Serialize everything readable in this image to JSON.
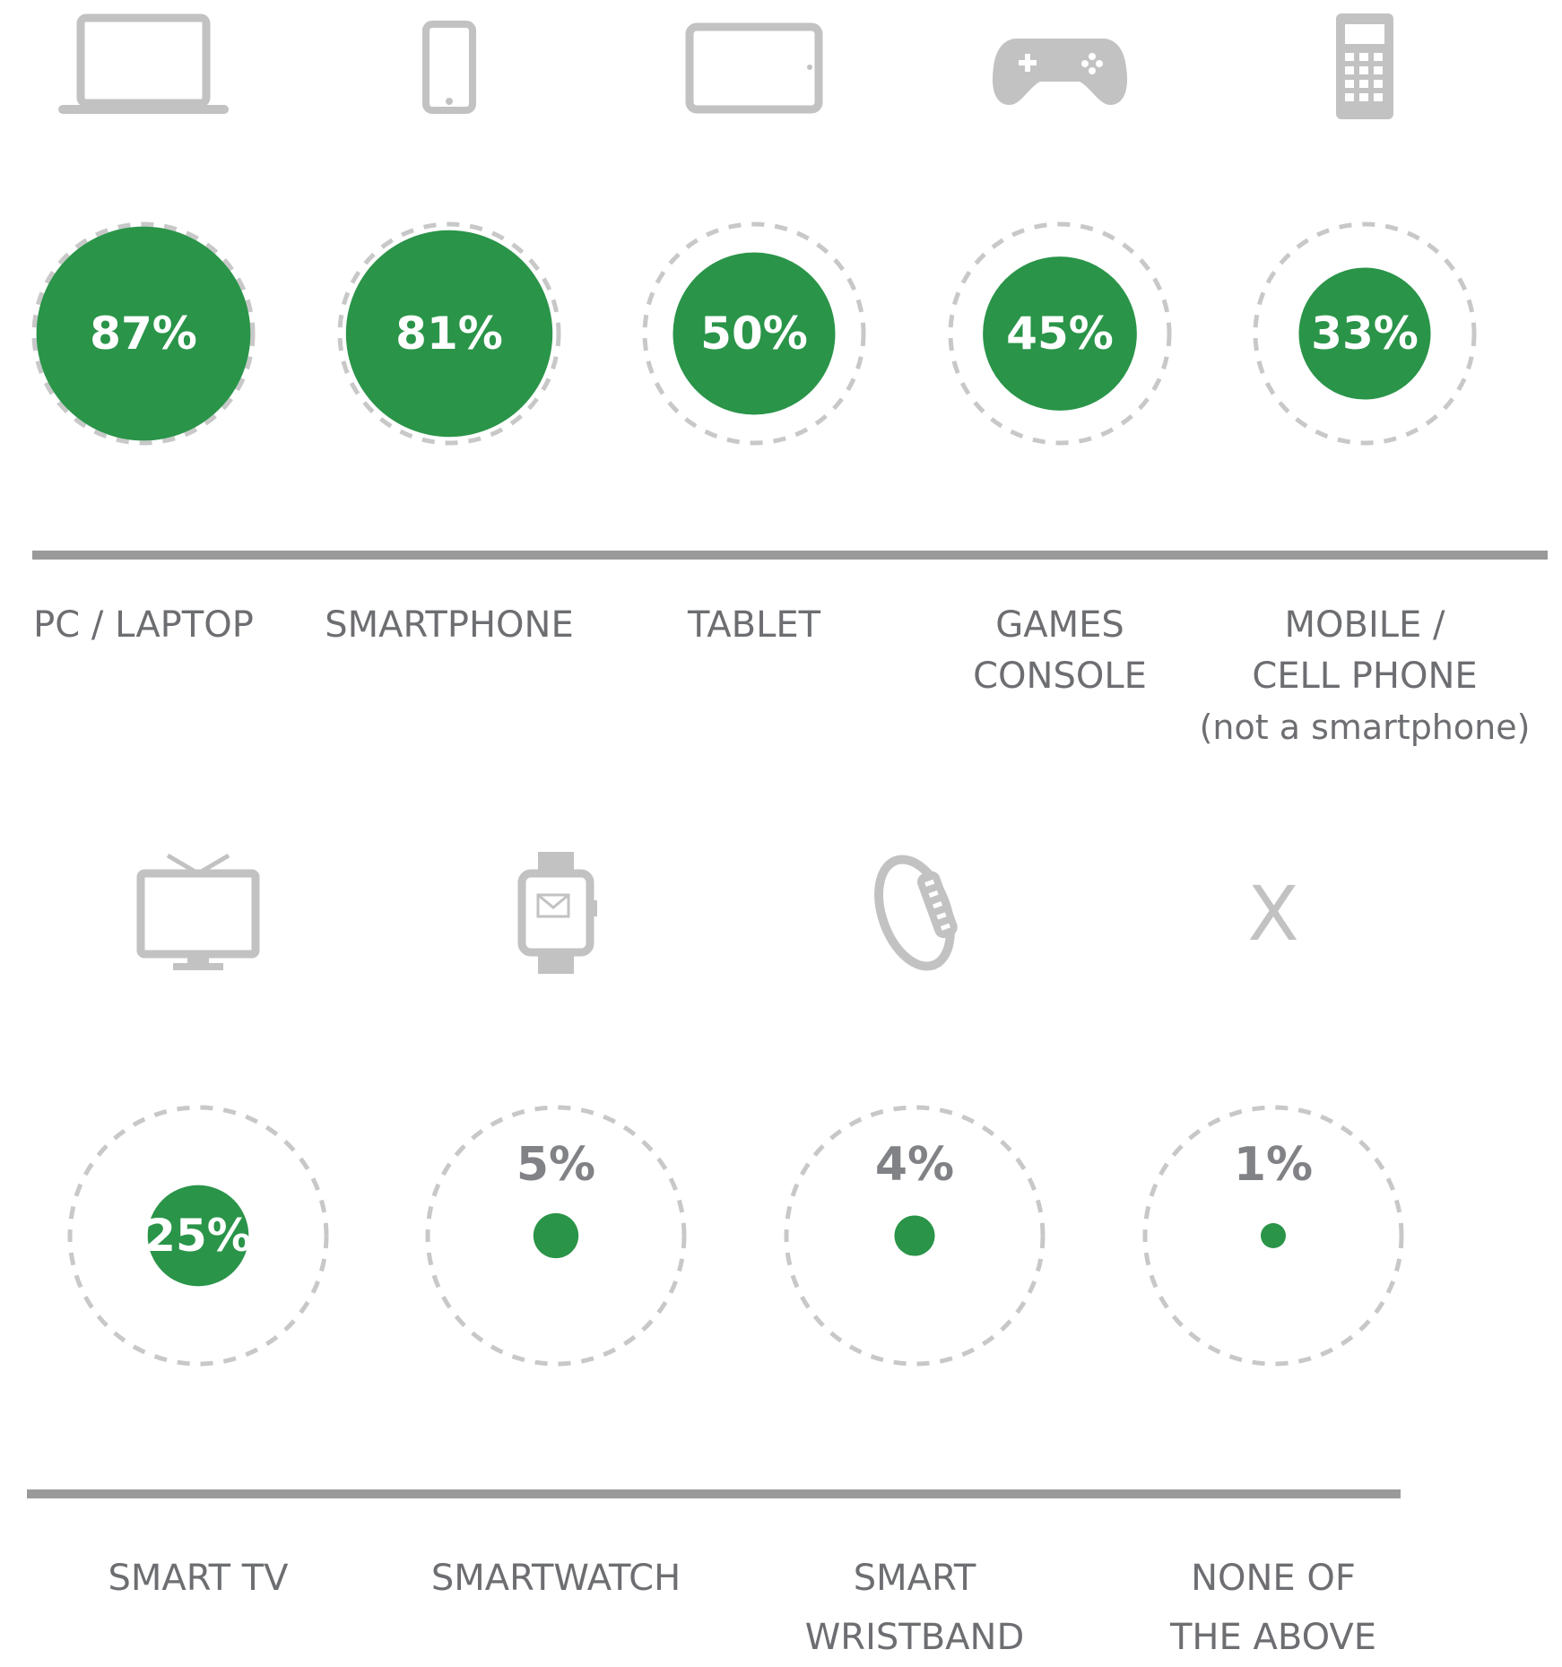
{
  "chart_data": {
    "type": "bubble",
    "unit": "%",
    "max_value": 100,
    "colors": {
      "bubble": "#2a9449",
      "ring": "#c8c8c8",
      "divider": "#9a9a9a",
      "icon": "#c2c2c2",
      "label": "#6d6e71",
      "outside_value": "#808285"
    },
    "rows": [
      {
        "items": [
          {
            "id": "pc-laptop",
            "icon": "laptop-icon",
            "label_lines": [
              "PC / LAPTOP"
            ],
            "value": 87,
            "value_label": "87%"
          },
          {
            "id": "smartphone",
            "icon": "smartphone-icon",
            "label_lines": [
              "SMARTPHONE"
            ],
            "value": 81,
            "value_label": "81%"
          },
          {
            "id": "tablet",
            "icon": "tablet-icon",
            "label_lines": [
              "TABLET"
            ],
            "value": 50,
            "value_label": "50%"
          },
          {
            "id": "games-console",
            "icon": "gamepad-icon",
            "label_lines": [
              "GAMES",
              "CONSOLE"
            ],
            "value": 45,
            "value_label": "45%"
          },
          {
            "id": "mobile-cell-phone",
            "icon": "cell-phone-icon",
            "label_lines": [
              "MOBILE /",
              "CELL PHONE",
              "(not a smartphone)"
            ],
            "value": 33,
            "value_label": "33%"
          }
        ]
      },
      {
        "items": [
          {
            "id": "smart-tv",
            "icon": "tv-icon",
            "label_lines": [
              "SMART TV"
            ],
            "value": 25,
            "value_label": "25%"
          },
          {
            "id": "smartwatch",
            "icon": "smartwatch-icon",
            "label_lines": [
              "SMARTWATCH"
            ],
            "value": 5,
            "value_label": "5%"
          },
          {
            "id": "smart-wristband",
            "icon": "wristband-icon",
            "label_lines": [
              "SMART",
              "WRISTBAND"
            ],
            "value": 4,
            "value_label": "4%"
          },
          {
            "id": "none-of-the-above",
            "icon": "x-icon",
            "label_lines": [
              "NONE OF",
              "THE ABOVE"
            ],
            "value": 1,
            "value_label": "1%",
            "icon_text": "X"
          }
        ]
      }
    ]
  }
}
